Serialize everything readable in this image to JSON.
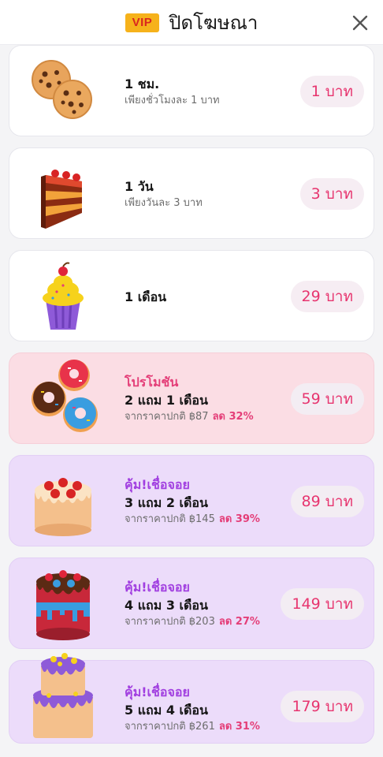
{
  "header": {
    "vip_label": "VIP",
    "title": "ปิดโฆษณา",
    "close_icon": "close-icon"
  },
  "plans": [
    {
      "icon": "cookies-icon",
      "tag": "",
      "title": "1 ชม.",
      "subtitle": "เพียงชั่วโมงละ 1 บาท",
      "discount": "",
      "price": "1 บาท"
    },
    {
      "icon": "cake-slice-icon",
      "tag": "",
      "title": "1 วัน",
      "subtitle": "เพียงวันละ 3 บาท",
      "discount": "",
      "price": "3 บาท"
    },
    {
      "icon": "cupcake-icon",
      "tag": "",
      "title": "1 เดือน",
      "subtitle": "",
      "discount": "",
      "price": "29 บาท"
    },
    {
      "icon": "donuts-icon",
      "tag": "โปรโมชัน",
      "title": "2 แถม 1 เดือน",
      "subtitle": "จากราคาปกติ ฿87",
      "discount": "ลด 32%",
      "price": "59 บาท"
    },
    {
      "icon": "strawberry-cake-icon",
      "tag": "คุ้ม!เชื่อจอย",
      "title": "3 แถม 2 เดือน",
      "subtitle": "จากราคาปกติ ฿145",
      "discount": "ลด 39%",
      "price": "89 บาท"
    },
    {
      "icon": "chocolate-cake-icon",
      "tag": "คุ้ม!เชื่อจอย",
      "title": "4 แถม 3 เดือน",
      "subtitle": "จากราคาปกติ ฿203",
      "discount": "ลด 27%",
      "price": "149 บาท"
    },
    {
      "icon": "tiered-cake-icon",
      "tag": "คุ้ม!เชื่อจอย",
      "title": "5 แถม 4 เดือน",
      "subtitle": "จากราคาปกติ ฿261",
      "discount": "ลด 31%",
      "price": "179 บาท"
    }
  ],
  "colors": {
    "accent_pink": "#e43e78",
    "accent_purple": "#a13fe0",
    "promo_bg": "#fbdde4",
    "value_bg": "#ecdcfa",
    "vip_bg": "#f6b21b"
  }
}
